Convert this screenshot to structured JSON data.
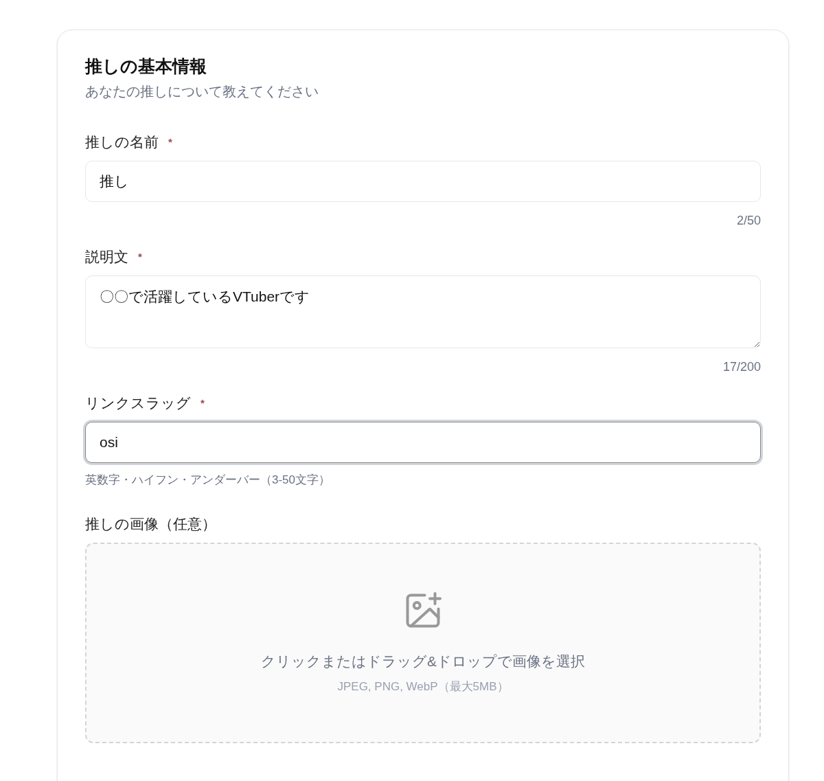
{
  "card": {
    "title": "推しの基本情報",
    "subtitle": "あなたの推しについて教えてください"
  },
  "fields": [
    {
      "kind": "text",
      "label": "推しの名前",
      "required": true,
      "value": "推し",
      "counter": "2/50",
      "focused": false
    },
    {
      "kind": "textarea",
      "label": "説明文",
      "required": true,
      "value": "〇〇で活躍しているVTuberです",
      "counter": "17/200",
      "focused": false
    },
    {
      "kind": "text",
      "label": "リンクスラッグ",
      "required": true,
      "value": "osi",
      "hint": "英数字・ハイフン・アンダーバー（3-50文字）",
      "focused": true
    },
    {
      "kind": "upload",
      "label": "推しの画像（任意）",
      "required": false,
      "prompt": "クリックまたはドラッグ&ドロップで画像を選択",
      "formats": "JPEG, PNG, WebP（最大5MB）"
    }
  ],
  "required_mark": "*"
}
